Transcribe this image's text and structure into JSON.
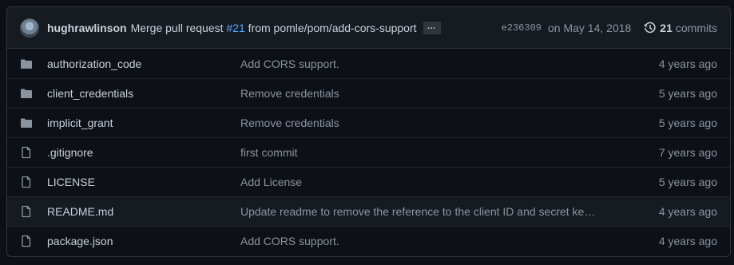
{
  "commit": {
    "author": "hughrawlinson",
    "message_prefix": "Merge pull request ",
    "pr_number": "#21",
    "message_suffix": " from pomle/pom/add-cors-support",
    "ellipsis": "…",
    "sha": "e236309",
    "date": "on May 14, 2018",
    "commits_count": "21",
    "commits_label": "commits"
  },
  "icons": {
    "folder": "folder-icon",
    "file": "file-icon",
    "history": "history-icon"
  },
  "colors": {
    "link": "#58a6ff",
    "folder": "#8b949e",
    "background": "#0d1117"
  },
  "files": [
    {
      "type": "folder",
      "name": "authorization_code",
      "message": "Add CORS support.",
      "age": "4 years ago"
    },
    {
      "type": "folder",
      "name": "client_credentials",
      "message": "Remove credentials",
      "age": "5 years ago"
    },
    {
      "type": "folder",
      "name": "implicit_grant",
      "message": "Remove credentials",
      "age": "5 years ago"
    },
    {
      "type": "file",
      "name": ".gitignore",
      "message": "first commit",
      "age": "7 years ago"
    },
    {
      "type": "file",
      "name": "LICENSE",
      "message": "Add License",
      "age": "5 years ago"
    },
    {
      "type": "file",
      "name": "README.md",
      "message": "Update readme to remove the reference to the client ID and secret ke…",
      "age": "4 years ago"
    },
    {
      "type": "file",
      "name": "package.json",
      "message": "Add CORS support.",
      "age": "4 years ago"
    }
  ]
}
